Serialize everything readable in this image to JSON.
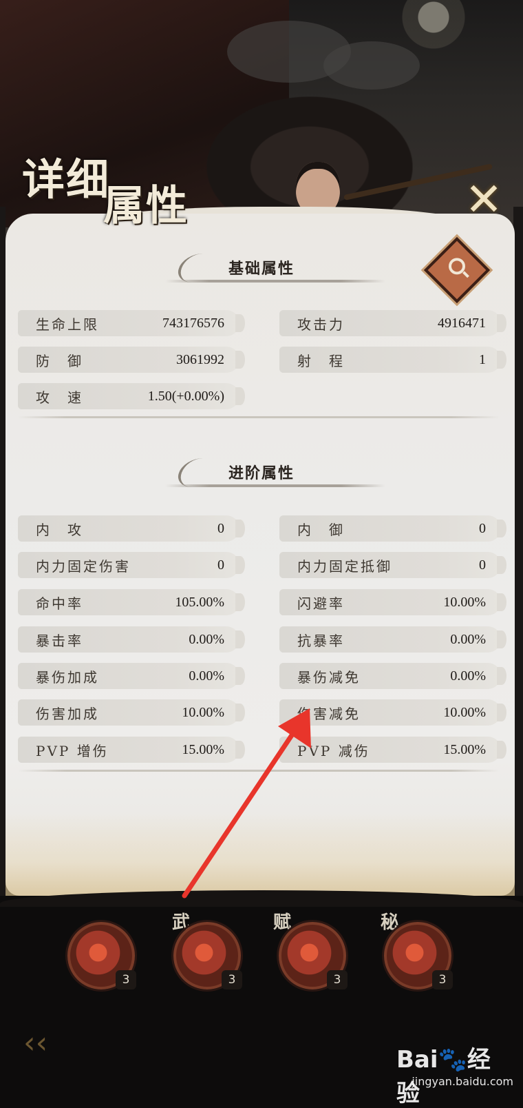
{
  "header": {
    "title_line1": "详细",
    "title_line2": "属性",
    "close_symbol": "✕"
  },
  "basic": {
    "title": "基础属性",
    "stats": [
      {
        "label": "生命上限",
        "value": "743176576"
      },
      {
        "label": "攻击力",
        "value": "4916471"
      },
      {
        "label": "防　御",
        "value": "3061992"
      },
      {
        "label": "射　程",
        "value": "1"
      },
      {
        "label": "攻　速",
        "value": "1.50(+0.00%)"
      }
    ]
  },
  "advanced": {
    "title": "进阶属性",
    "stats": [
      {
        "label": "内　攻",
        "value": "0"
      },
      {
        "label": "内　御",
        "value": "0"
      },
      {
        "label": "内力固定伤害",
        "value": "0"
      },
      {
        "label": "内力固定抵御",
        "value": "0"
      },
      {
        "label": "命中率",
        "value": "105.00%"
      },
      {
        "label": "闪避率",
        "value": "10.00%"
      },
      {
        "label": "暴击率",
        "value": "0.00%"
      },
      {
        "label": "抗暴率",
        "value": "0.00%"
      },
      {
        "label": "暴伤加成",
        "value": "0.00%"
      },
      {
        "label": "暴伤减免",
        "value": "0.00%"
      },
      {
        "label": "伤害加成",
        "value": "10.00%"
      },
      {
        "label": "伤害减免",
        "value": "10.00%"
      },
      {
        "label": "PVP 增伤",
        "value": "15.00%"
      },
      {
        "label": "PVP 减伤",
        "value": "15.00%"
      }
    ]
  },
  "skills": [
    {
      "tag": "",
      "count": "3"
    },
    {
      "tag": "武",
      "count": "3"
    },
    {
      "tag": "赋",
      "count": "3"
    },
    {
      "tag": "秘",
      "count": "3"
    }
  ],
  "watermark": {
    "main": "Bai🐾经验",
    "sub": "jingyan.baidu.com"
  },
  "colors": {
    "panel": "#ecebe9",
    "pill": "#dcdad5",
    "arrow": "#e8352b",
    "accent": "#b96a46"
  }
}
